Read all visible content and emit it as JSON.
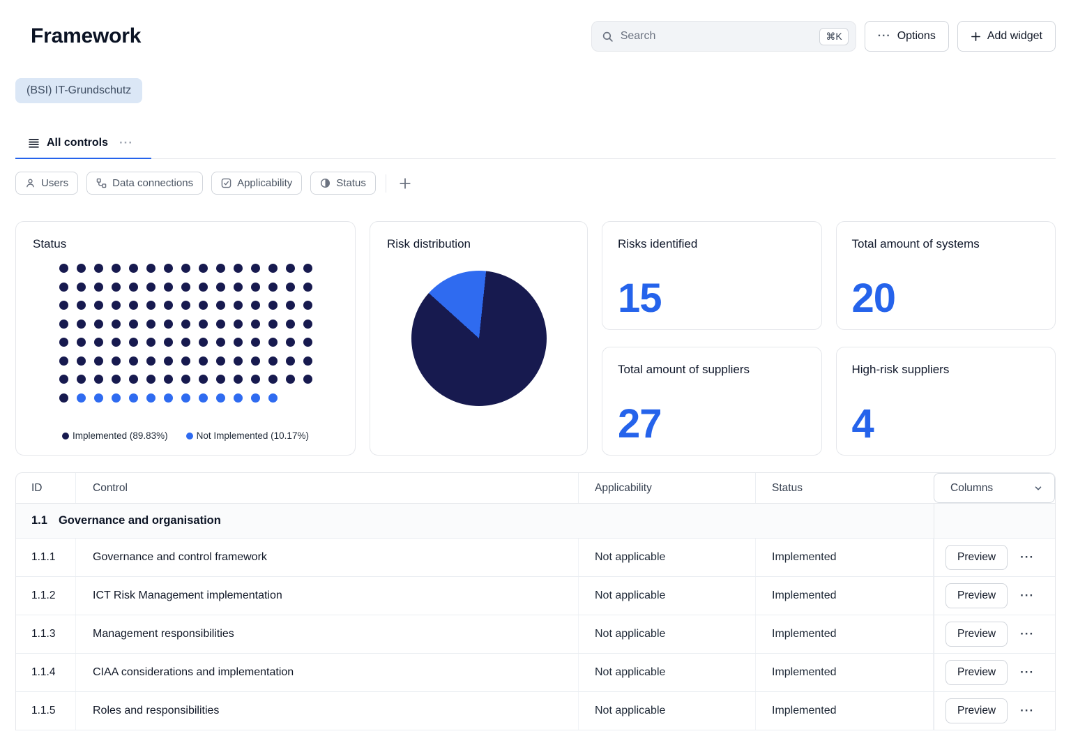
{
  "header": {
    "title": "Framework",
    "search": {
      "placeholder": "Search",
      "shortcut": "⌘K"
    },
    "options_label": "Options",
    "add_widget_label": "Add widget"
  },
  "framework_chip": "(BSI) IT-Grundschutz",
  "tabs": {
    "all_controls_label": "All controls"
  },
  "filters": [
    {
      "label": "Users",
      "icon": "user-icon"
    },
    {
      "label": "Data connections",
      "icon": "data-connections-icon"
    },
    {
      "label": "Applicability",
      "icon": "checkbox-icon"
    },
    {
      "label": "Status",
      "icon": "half-circle-icon"
    }
  ],
  "widgets": {
    "status": {
      "title": "Status",
      "legend": [
        {
          "label": "Implemented (89.83%)",
          "color": "#171a4f"
        },
        {
          "label": "Not Implemented (10.17%)",
          "color": "#2f6bf0"
        }
      ]
    },
    "risk_distribution": {
      "title": "Risk distribution"
    },
    "stats": [
      {
        "title": "Risks identified",
        "value": "15"
      },
      {
        "title": "Total amount of systems",
        "value": "20"
      },
      {
        "title": "Total amount of suppliers",
        "value": "27"
      },
      {
        "title": "High-risk suppliers",
        "value": "4"
      }
    ]
  },
  "chart_data": [
    {
      "type": "waffle",
      "title": "Status",
      "columns": 15,
      "total_dots": 118,
      "series": [
        {
          "name": "Implemented",
          "pct": 89.83,
          "dots": 106,
          "color": "#171a4f"
        },
        {
          "name": "Not Implemented",
          "pct": 10.17,
          "dots": 12,
          "color": "#2f6bf0"
        }
      ],
      "legend_position": "bottom"
    },
    {
      "type": "pie",
      "title": "Risk distribution",
      "slices": [
        {
          "name": "segment-1",
          "pct": 85,
          "color": "#171a4f"
        },
        {
          "name": "segment-2",
          "pct": 15,
          "color": "#2f6bf0"
        }
      ],
      "start_angle_deg": 6,
      "legend": "none"
    },
    {
      "type": "stat",
      "title": "Risks identified",
      "value": 15
    },
    {
      "type": "stat",
      "title": "Total amount of systems",
      "value": 20
    },
    {
      "type": "stat",
      "title": "Total amount of suppliers",
      "value": 27
    },
    {
      "type": "stat",
      "title": "High-risk suppliers",
      "value": 4
    }
  ],
  "table": {
    "columns": [
      "ID",
      "Control",
      "Applicability",
      "Status"
    ],
    "columns_button_label": "Columns",
    "group": {
      "id": "1.1",
      "label": "Governance and organisation"
    },
    "row_action_label": "Preview",
    "rows": [
      {
        "id": "1.1.1",
        "control": "Governance and control framework",
        "applicability": "Not applicable",
        "status": "Implemented"
      },
      {
        "id": "1.1.2",
        "control": "ICT Risk Management implementation",
        "applicability": "Not applicable",
        "status": "Implemented"
      },
      {
        "id": "1.1.3",
        "control": "Management responsibilities",
        "applicability": "Not applicable",
        "status": "Implemented"
      },
      {
        "id": "1.1.4",
        "control": "CIAA considerations and implementation",
        "applicability": "Not applicable",
        "status": "Implemented"
      },
      {
        "id": "1.1.5",
        "control": "Roles and responsibilities",
        "applicability": "Not applicable",
        "status": "Implemented"
      }
    ]
  },
  "colors": {
    "accent": "#2563eb",
    "navy": "#171a4f",
    "blue": "#2f6bf0"
  }
}
